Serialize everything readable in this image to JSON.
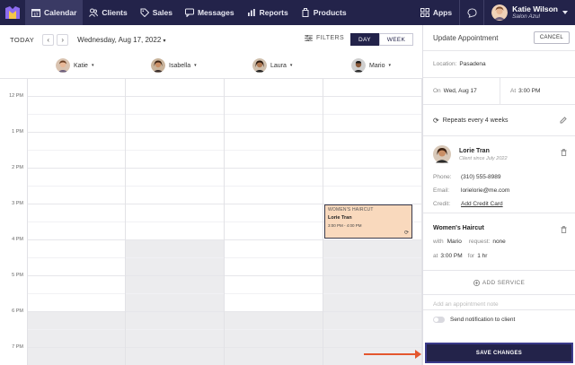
{
  "nav": {
    "items": [
      {
        "label": "Calendar",
        "icon": "calendar-icon",
        "active": true
      },
      {
        "label": "Clients",
        "icon": "clients-icon"
      },
      {
        "label": "Sales",
        "icon": "tag-icon"
      },
      {
        "label": "Messages",
        "icon": "messages-icon"
      },
      {
        "label": "Reports",
        "icon": "reports-icon"
      },
      {
        "label": "Products",
        "icon": "products-icon"
      }
    ],
    "apps_label": "Apps",
    "user": {
      "name": "Katie Wilson",
      "salon": "Salon Azul"
    }
  },
  "toolbar": {
    "today": "TODAY",
    "date": "Wednesday, Aug 17, 2022",
    "filters": "FILTERS",
    "day": "DAY",
    "week": "WEEK"
  },
  "staff": [
    "Katie",
    "Isabella",
    "Laura",
    "Mario"
  ],
  "hours": [
    "12 PM",
    "1 PM",
    "2 PM",
    "3 PM",
    "4 PM",
    "5 PM",
    "6 PM",
    "7 PM"
  ],
  "appointment": {
    "service": "WOMEN'S HAIRCUT",
    "client": "Lorie Tran",
    "time": "3:00 PM - 4:00 PM"
  },
  "panel": {
    "title": "Update Appointment",
    "cancel": "CANCEL",
    "location_label": "Location:",
    "location": "Pasadena",
    "on_label": "On",
    "on_date": "Wed, Aug 17",
    "at_label": "At",
    "at_time": "3:00 PM",
    "repeats": "Repeats every 4 weeks",
    "client_name": "Lorie Tran",
    "client_since": "Client since July 2022",
    "phone_label": "Phone:",
    "phone": "(310) 555-8989",
    "email_label": "Email:",
    "email": "lorielorie@me.com",
    "credit_label": "Credit:",
    "credit": "Add Credit Card",
    "service_title": "Women's Haircut",
    "with_label": "with",
    "with_staff": "Mario",
    "request_label": "request:",
    "request_val": "none",
    "at2_label": "at",
    "at2_time": "3:00 PM",
    "for_label": "for",
    "duration": "1 hr",
    "add_service": "ADD SERVICE",
    "note_placeholder": "Add an appointment note",
    "notify": "Send notification to client",
    "save": "SAVE CHANGES"
  }
}
